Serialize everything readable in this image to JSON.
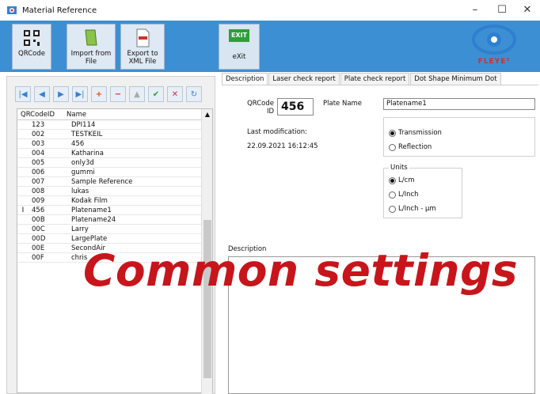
{
  "window": {
    "title": "Material Reference",
    "minimize": "–",
    "maximize": "☐",
    "close": "✕"
  },
  "toolbar": {
    "qrcode": "QRCode",
    "import": "Import from File",
    "export": "Export to XML File",
    "exit": "eXit",
    "exit_badge": "EXIT",
    "logo_text": "FLEYE³"
  },
  "nav": {
    "first": "|◀",
    "prev": "◀",
    "next": "▶",
    "last": "▶|",
    "add": "+",
    "delete": "−",
    "edit": "▲",
    "post": "✔",
    "cancel": "✕",
    "refresh": "↻"
  },
  "grid": {
    "headers": [
      "QRCodeID",
      "Name"
    ],
    "rows": [
      {
        "id": "123",
        "name": "DPI114",
        "mark": ""
      },
      {
        "id": "002",
        "name": "TESTKEIL",
        "mark": ""
      },
      {
        "id": "003",
        "name": "456",
        "mark": ""
      },
      {
        "id": "004",
        "name": "Katharina",
        "mark": ""
      },
      {
        "id": "005",
        "name": "only3d",
        "mark": ""
      },
      {
        "id": "006",
        "name": "gummi",
        "mark": ""
      },
      {
        "id": "007",
        "name": "Sample Reference",
        "mark": ""
      },
      {
        "id": "008",
        "name": "lukas",
        "mark": ""
      },
      {
        "id": "009",
        "name": "Kodak Film",
        "mark": ""
      },
      {
        "id": "456",
        "name": "Platename1",
        "mark": "I"
      },
      {
        "id": "00B",
        "name": "Platename24",
        "mark": ""
      },
      {
        "id": "00C",
        "name": "Larry",
        "mark": ""
      },
      {
        "id": "00D",
        "name": "LargePlate",
        "mark": ""
      },
      {
        "id": "00E",
        "name": "SecondAir",
        "mark": ""
      },
      {
        "id": "00F",
        "name": "chris",
        "mark": ""
      }
    ]
  },
  "tabs": [
    "Description",
    "Laser check report",
    "Plate check report",
    "Dot Shape Minimum Dot"
  ],
  "description": {
    "qrcode_label": "QRCode ID",
    "qrcode_value": "456",
    "plate_name_label": "Plate Name",
    "plate_name_value": "Platename1",
    "last_mod_label": "Last modification:",
    "last_mod_value": "22.09.2021 16:12:45",
    "transmission": "Transmission",
    "reflection": "Reflection",
    "units_label": "Units",
    "unit_lcm": "L/cm",
    "unit_linch": "L/Inch",
    "unit_linch_um": "L/Inch - µm",
    "description_label": "Description"
  },
  "overlay_text": "Common settings",
  "colors": {
    "toolbar_bg": "#3d8fd3",
    "overlay": "#c8151b",
    "exit_green": "#2e9e3a"
  }
}
